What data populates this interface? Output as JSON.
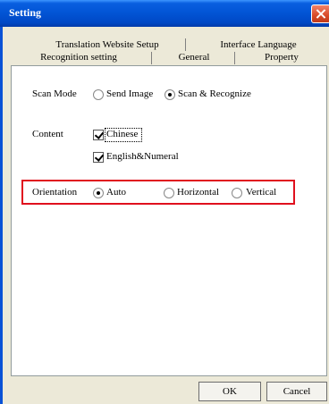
{
  "window": {
    "title": "Setting"
  },
  "tabs": {
    "row1": [
      "Translation Website Setup",
      "Interface Language"
    ],
    "row2": [
      "Recognition setting",
      "General",
      "Property"
    ],
    "active": "Property"
  },
  "property": {
    "scan_mode": {
      "label": "Scan Mode",
      "options": [
        "Send Image",
        "Scan & Recognize"
      ],
      "selected": "Scan & Recognize"
    },
    "content": {
      "label": "Content",
      "options": [
        "Chinese",
        "English&Numeral"
      ],
      "checked": [
        "Chinese",
        "English&Numeral"
      ]
    },
    "orientation": {
      "label": "Orientation",
      "options": [
        "Auto",
        "Horizontal",
        "Vertical"
      ],
      "selected": "Auto"
    }
  },
  "buttons": {
    "ok": "OK",
    "cancel": "Cancel"
  },
  "colors": {
    "titlebar": "#0255d6",
    "highlight_border": "#e0101e",
    "dialog_background": "#ece9d8"
  }
}
